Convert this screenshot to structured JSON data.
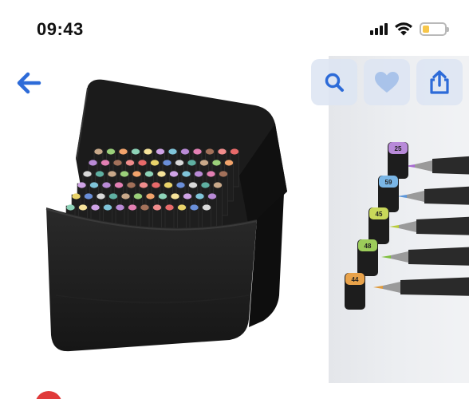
{
  "status_bar": {
    "time": "09:43",
    "signal_bars": 4,
    "wifi": true,
    "battery_level": 0.3,
    "battery_color": "#f7c64a"
  },
  "toolbar": {
    "back_icon": "arrow-left-icon",
    "search_icon": "magnifier-icon",
    "favorite_icon": "heart-icon",
    "share_icon": "share-icon",
    "accent_color": "#2d6bd8"
  },
  "gallery": {
    "images": [
      {
        "subject": "black marker storage bag with colored markers"
      },
      {
        "subject": "markers with caps arranged diagonally"
      }
    ],
    "marker_labels": [
      "25",
      "59",
      "45",
      "48",
      "44"
    ]
  }
}
